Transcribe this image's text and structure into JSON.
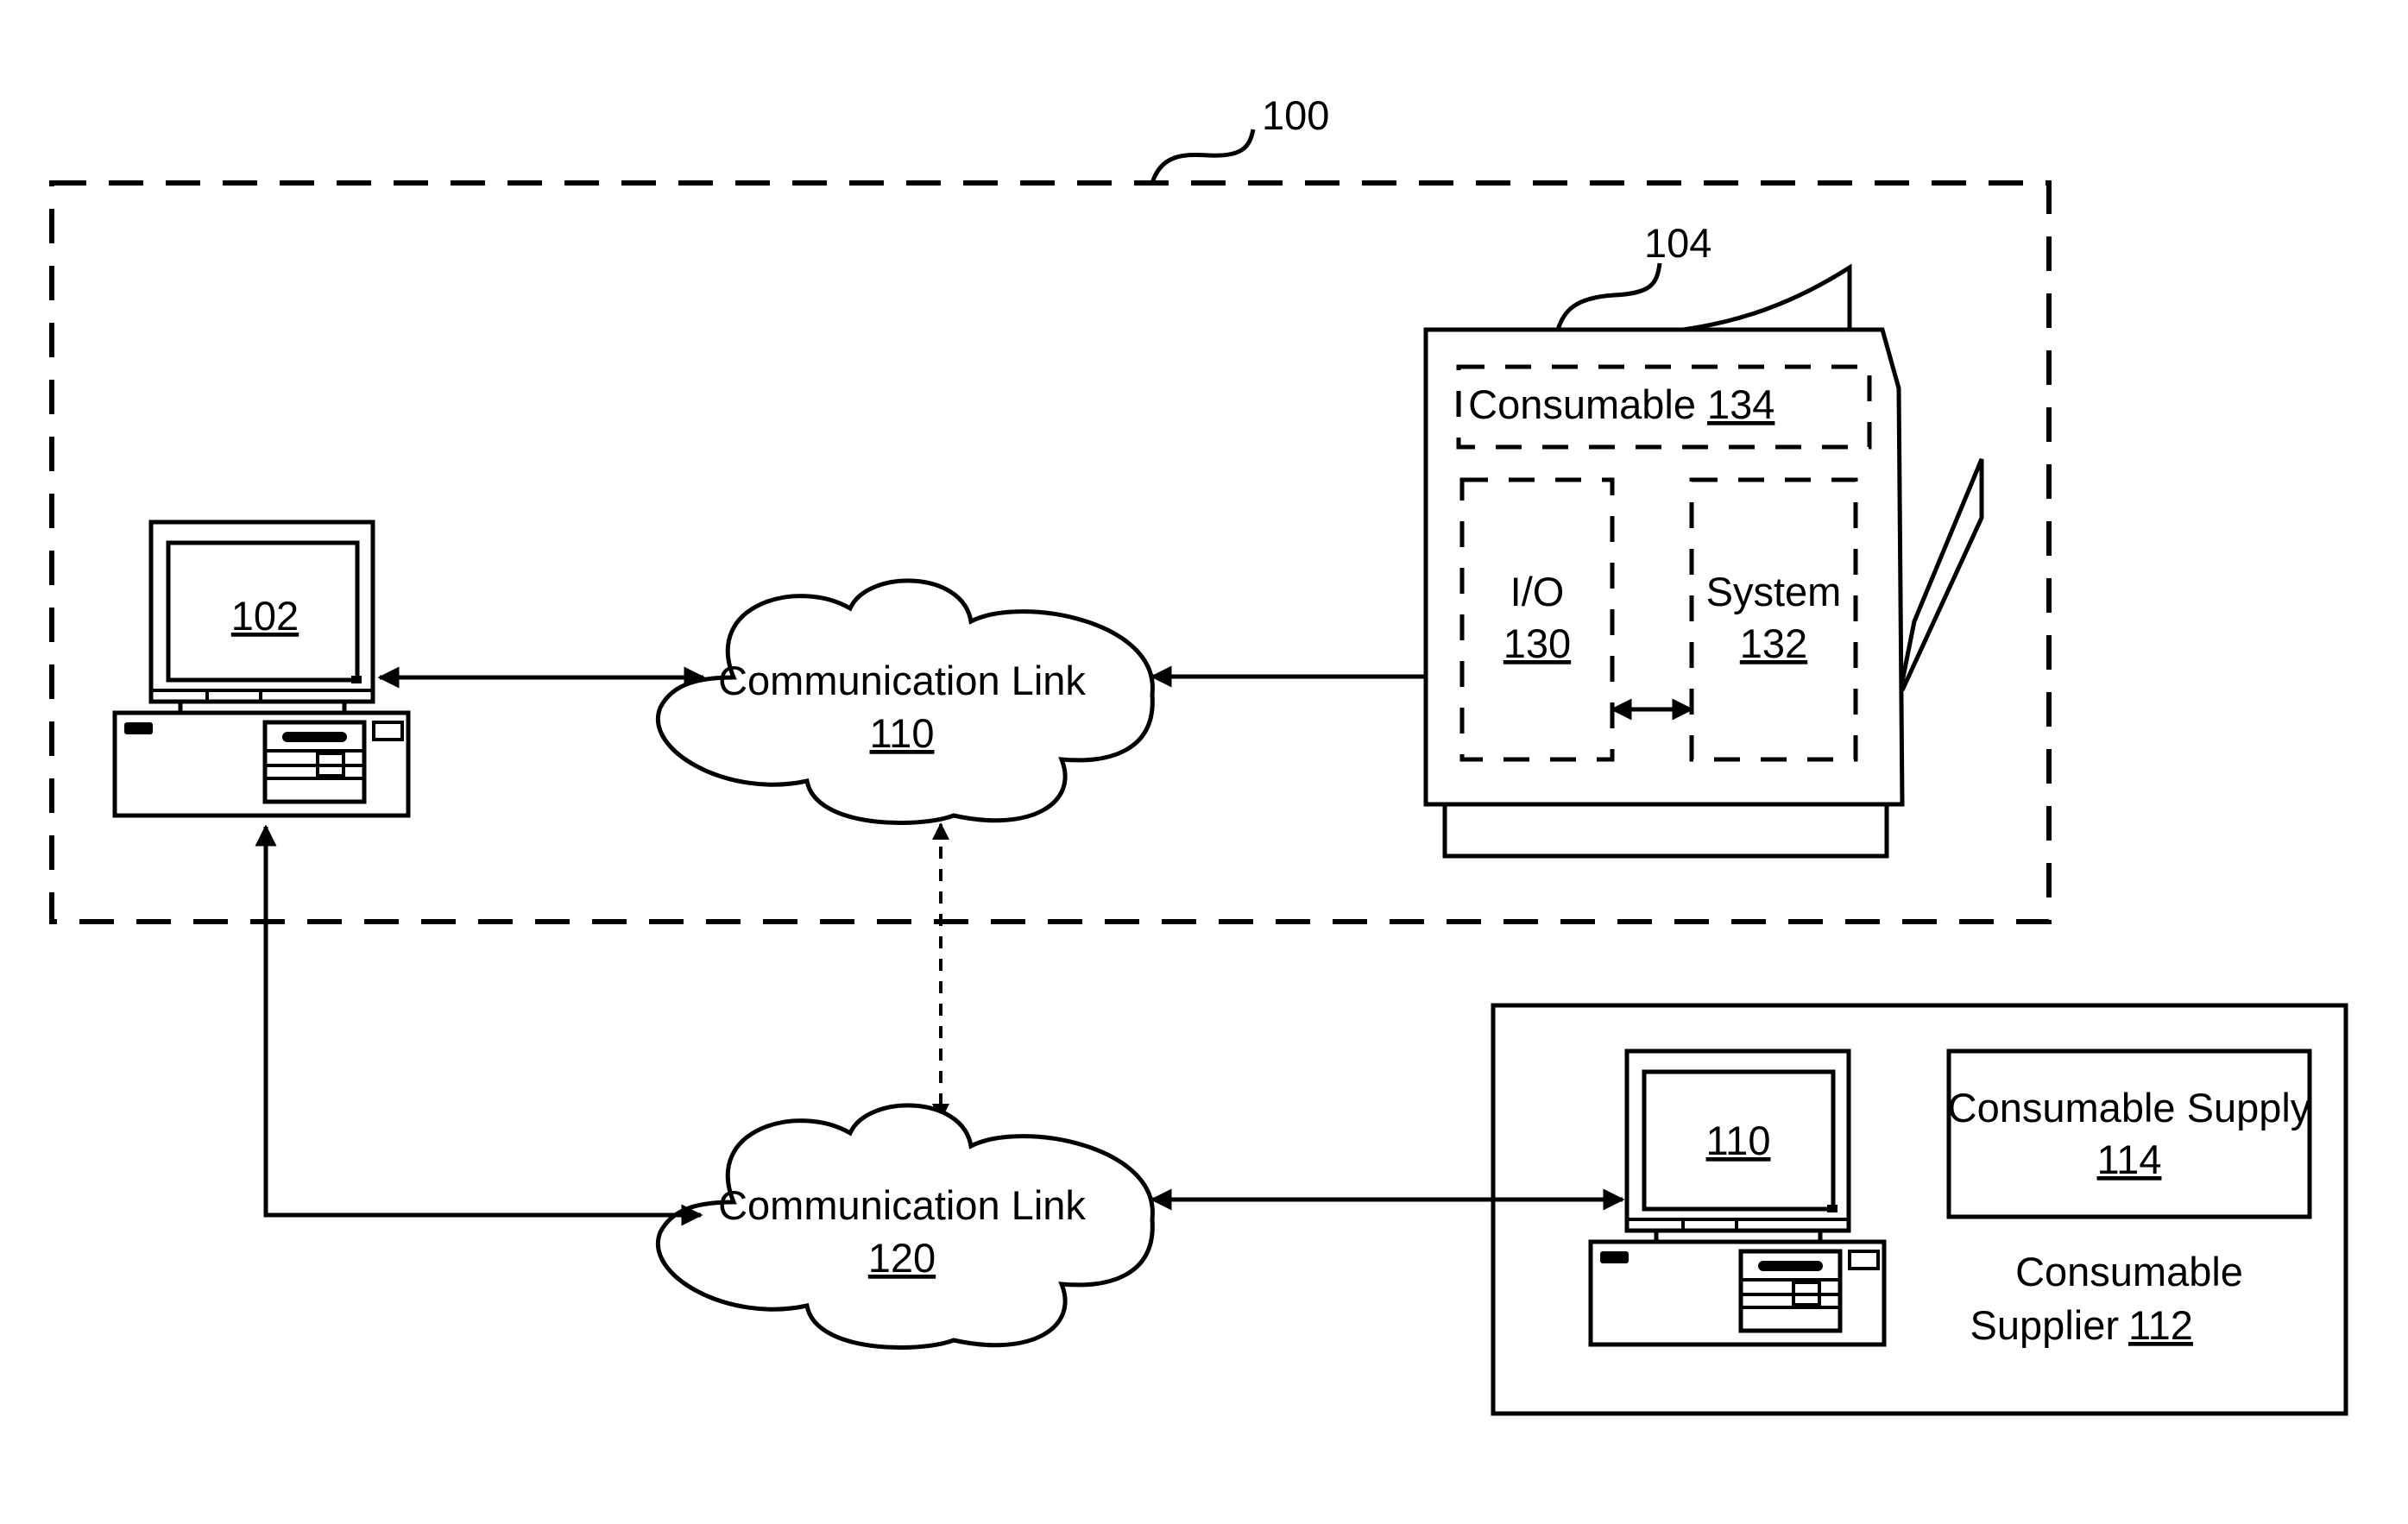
{
  "diagram": {
    "system": {
      "ref": "100"
    },
    "computer_client": {
      "ref": "102"
    },
    "printer": {
      "ref": "104",
      "consumable": {
        "label": "Consumable",
        "ref": "134"
      },
      "io": {
        "label": "I/O",
        "ref": "130"
      },
      "system": {
        "label": "System",
        "ref": "132"
      }
    },
    "link_upper": {
      "label": "Communication Link",
      "ref": "110"
    },
    "link_lower": {
      "label": "Communication Link",
      "ref": "120"
    },
    "supplier": {
      "label_line1": "Consumable",
      "label_line2": "Supplier",
      "ref": "112",
      "computer": {
        "ref": "110"
      },
      "supply": {
        "label": "Consumable Supply",
        "ref": "114"
      }
    }
  }
}
